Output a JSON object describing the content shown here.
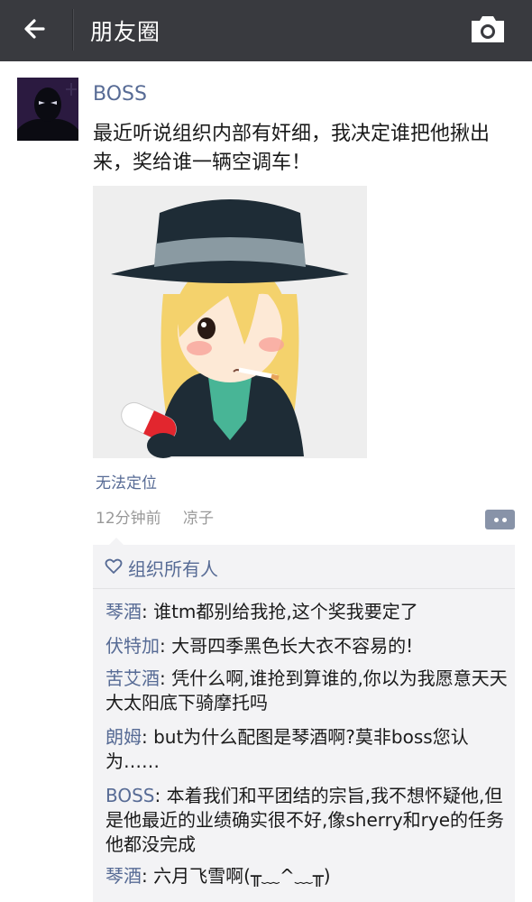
{
  "header": {
    "title": "朋友圈",
    "back_icon": "back-arrow-icon",
    "camera_icon": "camera-icon"
  },
  "post": {
    "username": "BOSS",
    "text": "最近听说组织内部有奸细，我决定谁把他揪出来，奖给谁一辆空调车！",
    "location": "无法定位",
    "time": "12分钟前",
    "source": "凉子"
  },
  "likes": {
    "names": "组织所有人",
    "icon": "heart-outline-icon"
  },
  "comments": [
    {
      "name": "琴酒",
      "text": ": 谁tm都别给我抢,这个奖我要定了"
    },
    {
      "name": "伏特加",
      "text": ": 大哥四季黑色长大衣不容易的!"
    },
    {
      "name": "苦艾酒",
      "text": ": 凭什么啊,谁抢到算谁的,你以为我愿意天天大太阳底下骑摩托吗"
    },
    {
      "name": "朗姆",
      "text": ": but为什么配图是琴酒啊?莫非boss您认为……"
    },
    {
      "name": "BOSS",
      "text": ": 本着我们和平团结的宗旨,我不想怀疑他,但是他最近的业绩确实很不好,像sherry和rye的任务他都没完成"
    },
    {
      "name": "琴酒",
      "text": ": 六月飞雪啊(╥﹏^﹏╥)"
    }
  ],
  "colors": {
    "topbar": "#393a3f",
    "link": "#576b95",
    "comment_bg": "#f3f3f5"
  }
}
